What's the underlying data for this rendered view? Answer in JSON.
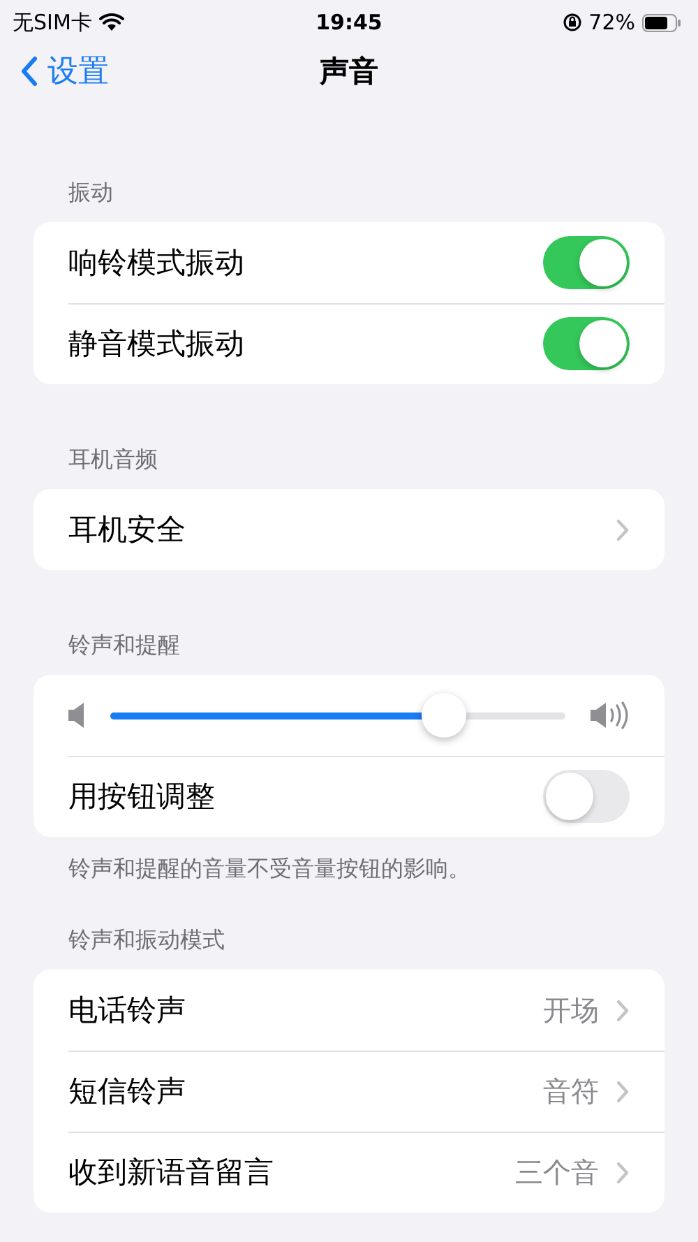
{
  "status_bar": {
    "carrier": "无SIM卡",
    "time": "19:45",
    "battery": "72%"
  },
  "nav": {
    "back": "设置",
    "title": "声音"
  },
  "groups": [
    {
      "header": "振动",
      "rows": [
        {
          "kind": "toggle",
          "label": "响铃模式振动",
          "on": true
        },
        {
          "kind": "toggle",
          "label": "静音模式振动",
          "on": true
        }
      ]
    },
    {
      "header": "耳机音频",
      "rows": [
        {
          "kind": "link",
          "label": "耳机安全"
        }
      ]
    },
    {
      "header": "铃声和提醒",
      "rows": [
        {
          "kind": "slider",
          "level": 0.734
        },
        {
          "kind": "toggle",
          "label": "用按钮调整",
          "on": false
        }
      ],
      "footer": "铃声和提醒的音量不受音量按钮的影响。"
    },
    {
      "header": "铃声和振动模式",
      "rows": [
        {
          "kind": "link",
          "label": "电话铃声",
          "value": "开场"
        },
        {
          "kind": "link",
          "label": "短信铃声",
          "value": "音符"
        },
        {
          "kind": "link",
          "label": "收到新语音留言",
          "value": "三个音"
        }
      ]
    }
  ]
}
